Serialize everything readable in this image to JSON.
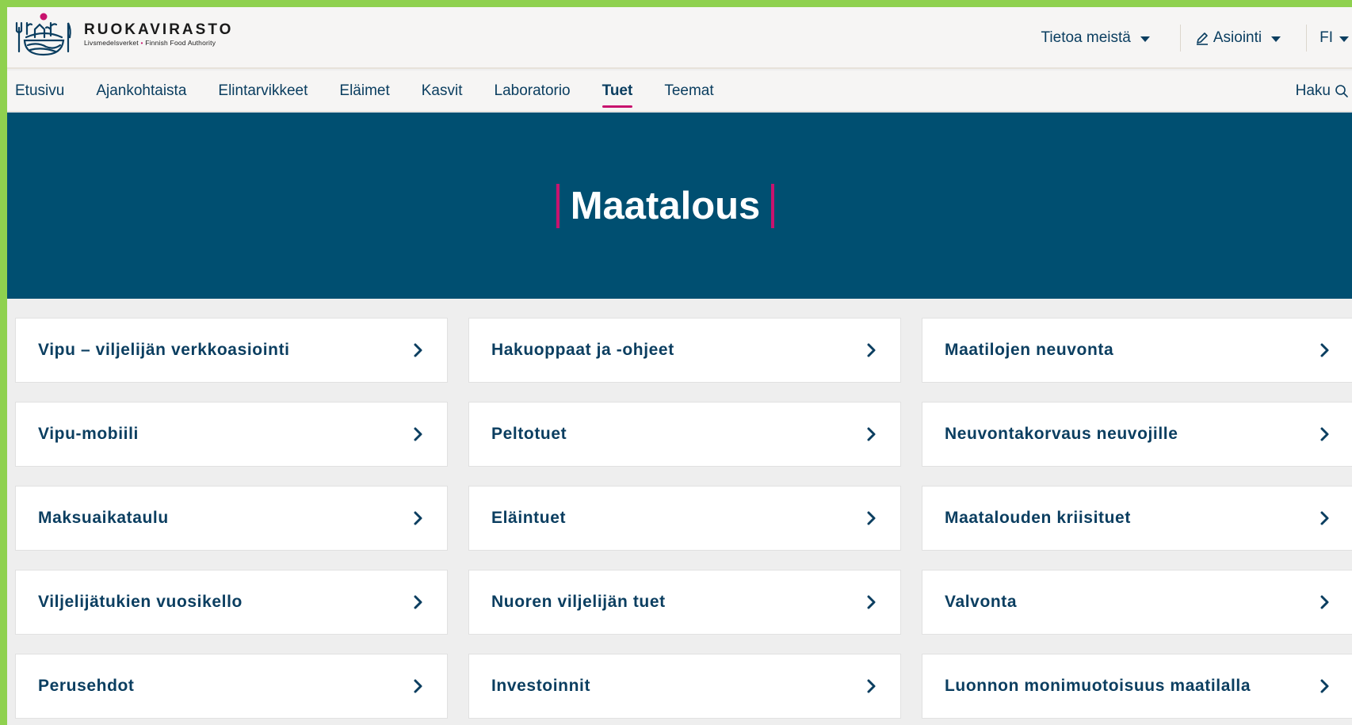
{
  "header": {
    "logo": {
      "name": "RUOKAVIRASTO",
      "sub_left": "Livsmedelsverket",
      "sub_sep": "•",
      "sub_right": "Finnish Food Authority"
    },
    "menu": {
      "about_label": "Tietoa meistä",
      "services_label": "Asiointi",
      "language_label": "FI"
    }
  },
  "nav": {
    "items": [
      {
        "label": "Etusivu"
      },
      {
        "label": "Ajankohtaista"
      },
      {
        "label": "Elintarvikkeet"
      },
      {
        "label": "Eläimet"
      },
      {
        "label": "Kasvit"
      },
      {
        "label": "Laboratorio"
      },
      {
        "label": "Tuet",
        "active": true
      },
      {
        "label": "Teemat"
      }
    ],
    "search_label": "Haku"
  },
  "hero": {
    "title": "Maatalous"
  },
  "cards": [
    {
      "label": "Vipu – viljelijän verkkoasiointi"
    },
    {
      "label": "Hakuoppaat ja -ohjeet"
    },
    {
      "label": "Maatilojen neuvonta"
    },
    {
      "label": "Vipu-mobiili"
    },
    {
      "label": "Peltotuet"
    },
    {
      "label": "Neuvontakorvaus neuvojille"
    },
    {
      "label": "Maksuaikataulu"
    },
    {
      "label": "Eläintuet"
    },
    {
      "label": "Maatalouden kriisituet"
    },
    {
      "label": "Viljelijätukien vuosikello"
    },
    {
      "label": "Nuoren viljelijän tuet"
    },
    {
      "label": "Valvonta"
    },
    {
      "label": "Perusehdot"
    },
    {
      "label": "Investoinnit"
    },
    {
      "label": "Luonnon monimuotoisuus maatilalla"
    }
  ],
  "colors": {
    "accent": "#c8136e",
    "brand_dark": "#004f71",
    "text_primary": "#0b3e60"
  },
  "icons": {
    "logo": "ruokavirasto-logo-icon",
    "pen": "pen-icon",
    "caret": "caret-down-icon",
    "search": "search-icon",
    "chevron": "chevron-right-icon"
  }
}
